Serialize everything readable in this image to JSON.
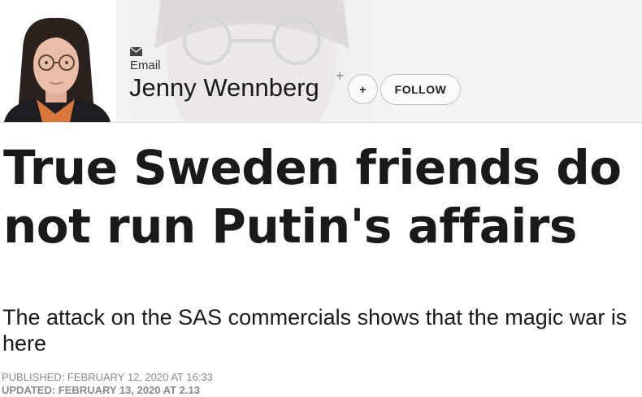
{
  "author": {
    "email_label": "Email",
    "name": "Jenny Wennberg",
    "plus_mark": "+",
    "plus_button_label": "+",
    "follow_label": "FOLLOW",
    "icons": [
      "email-icon",
      "author-avatar"
    ]
  },
  "article": {
    "headline": "True Sweden friends do not run Putin's affairs",
    "subheading": "The attack on the SAS commercials shows that the magic war is here",
    "published": "PUBLISHED: FEBRUARY 12, 2020 AT 16:33",
    "updated": "UPDATED: FEBRUARY 13, 2020 AT 2.13"
  },
  "colors": {
    "header_bg": "#f4f4f6",
    "text": "#1a1a1a",
    "meta_text": "#8a8a8a",
    "author_shirt": "#d9773a"
  }
}
